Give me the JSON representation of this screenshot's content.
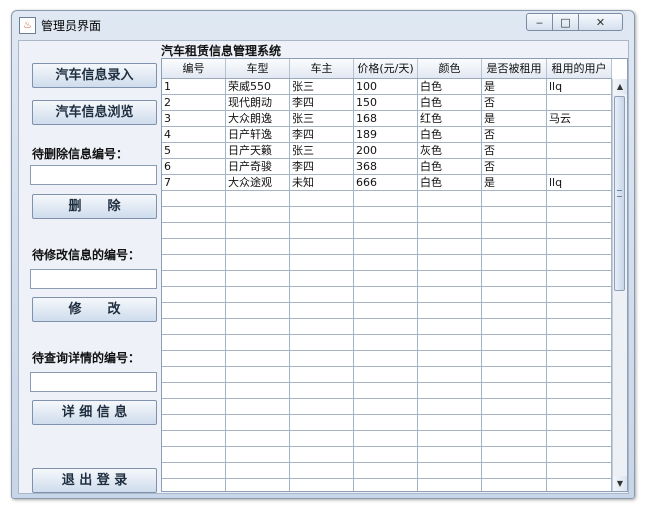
{
  "window": {
    "title": "管理员界面",
    "icon": "java-cup-icon",
    "controls": {
      "minimize": "‒",
      "maximize": "□",
      "close": "✕"
    }
  },
  "sidebar": {
    "add_button": "汽车信息录入",
    "browse_button": "汽车信息浏览",
    "delete_label": "待删除信息编号：",
    "delete_value": "",
    "delete_button": "删　　除",
    "modify_label": "待修改信息的编号：",
    "modify_value": "",
    "modify_button": "修　　改",
    "query_label": "待查询详情的编号：",
    "query_value": "",
    "detail_button": "详 细 信 息",
    "logout_button": "退 出 登 录"
  },
  "main": {
    "system_title": "汽车租赁信息管理系统",
    "columns": [
      "编号",
      "车型",
      "车主",
      "价格(元/天)",
      "颜色",
      "是否被租用",
      "租用的用户"
    ],
    "rows": [
      [
        "1",
        "荣威550",
        "张三",
        "100",
        "白色",
        "是",
        "llq"
      ],
      [
        "2",
        "现代朗动",
        "李四",
        "150",
        "白色",
        "否",
        ""
      ],
      [
        "3",
        "大众朗逸",
        "张三",
        "168",
        "红色",
        "是",
        "马云"
      ],
      [
        "4",
        "日产轩逸",
        "李四",
        "189",
        "白色",
        "否",
        ""
      ],
      [
        "5",
        "日产天籁",
        "张三",
        "200",
        "灰色",
        "否",
        ""
      ],
      [
        "6",
        "日产奇骏",
        "李四",
        "368",
        "白色",
        "否",
        ""
      ],
      [
        "7",
        "大众途观",
        "未知",
        "666",
        "白色",
        "是",
        "llq"
      ]
    ],
    "empty_row_count": 19
  },
  "colors": {
    "title_bar": "#dfe8f3",
    "client_bg": "#eef2f8",
    "grid_line": "#a4b3c6",
    "button_bg": "#cfdcec"
  }
}
